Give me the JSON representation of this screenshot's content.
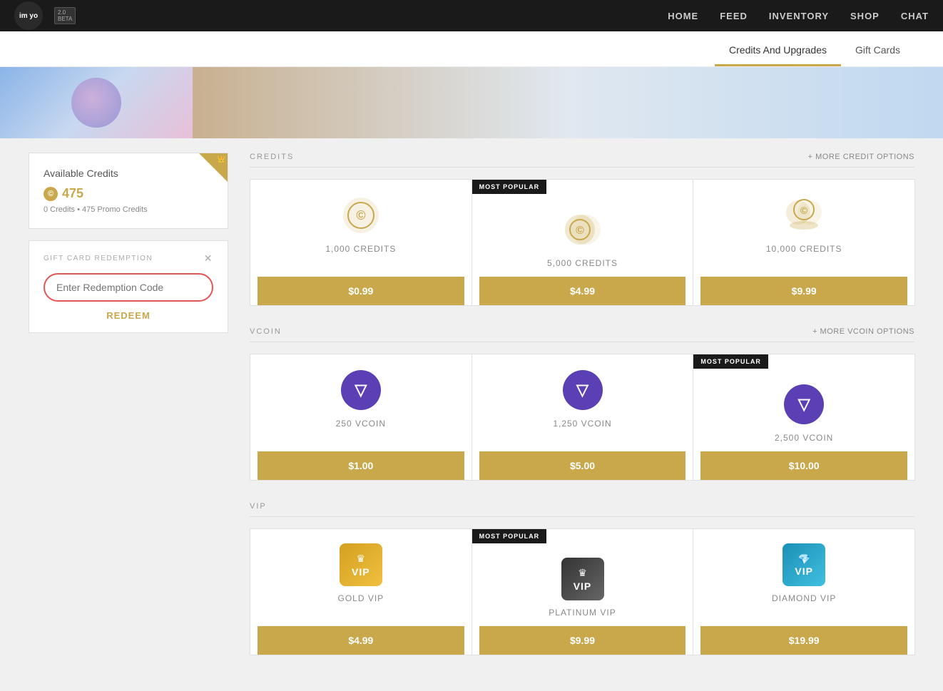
{
  "header": {
    "logo_text": "im\nyo",
    "beta_label": "2.0\nBETA",
    "nav_items": [
      "HOME",
      "FEED",
      "INVENTORY",
      "SHOP",
      "CHAT"
    ]
  },
  "sub_nav": {
    "items": [
      {
        "label": "Credits And Upgrades",
        "active": true
      },
      {
        "label": "Gift Cards",
        "active": false
      }
    ]
  },
  "credits": {
    "title": "Available Credits",
    "amount": "475",
    "icon": "©",
    "detail": "0 Credits • 475 Promo Credits"
  },
  "gift_card": {
    "label": "GIFT CARD REDEMPTION",
    "placeholder": "Enter Redemption Code",
    "redeem_label": "REDEEM"
  },
  "credits_section": {
    "title": "CREDITS",
    "more_options": "+ MORE CREDIT OPTIONS",
    "products": [
      {
        "name": "1,000 CREDITS",
        "price": "$0.99",
        "most_popular": false,
        "icon_type": "coin-single"
      },
      {
        "name": "5,000 CREDITS",
        "price": "$4.99",
        "most_popular": true,
        "icon_type": "coin-double"
      },
      {
        "name": "10,000 CREDITS",
        "price": "$9.99",
        "most_popular": false,
        "icon_type": "coin-stack"
      }
    ]
  },
  "vcoin_section": {
    "title": "VCOIN",
    "more_options": "+ MORE VCOIN OPTIONS",
    "products": [
      {
        "name": "250 VCOIN",
        "price": "$1.00",
        "most_popular": false
      },
      {
        "name": "1,250 VCOIN",
        "price": "$5.00",
        "most_popular": false
      },
      {
        "name": "2,500 VCOIN",
        "price": "$10.00",
        "most_popular": true
      }
    ]
  },
  "vip_section": {
    "title": "VIP",
    "products": [
      {
        "name": "GOLD VIP",
        "price": "$4.99",
        "most_popular": false,
        "type": "gold"
      },
      {
        "name": "PLATINUM VIP",
        "price": "$9.99",
        "most_popular": true,
        "type": "platinum"
      },
      {
        "name": "DIAMOND VIP",
        "price": "$19.99",
        "most_popular": false,
        "type": "diamond"
      }
    ]
  }
}
